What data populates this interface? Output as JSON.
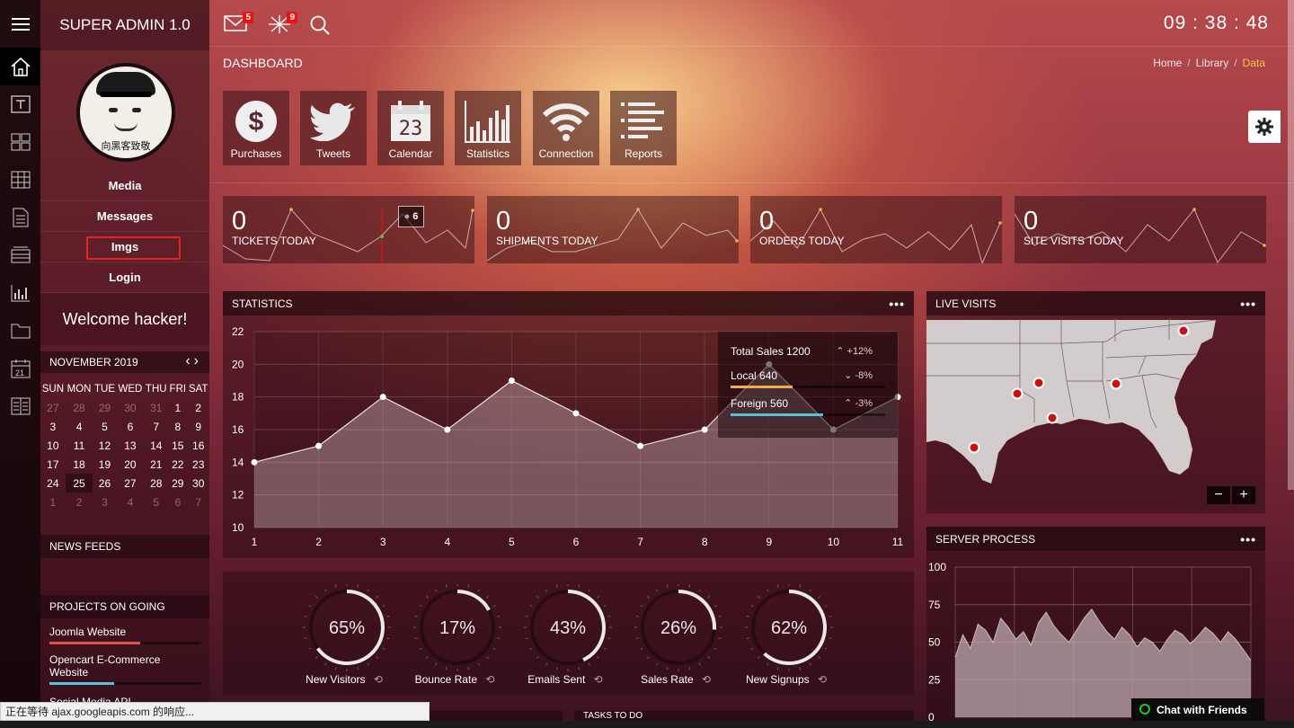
{
  "app": {
    "brand": "SUPER ADMIN 1.0"
  },
  "header": {
    "mail_badge": "5",
    "alerts_badge": "9",
    "clock": "09 : 38 : 48"
  },
  "page": {
    "title": "DASHBOARD",
    "breadcrumb": [
      "Home",
      "Library",
      "Data"
    ]
  },
  "sidebar": {
    "avatar_caption": "向黑客致敬",
    "links": [
      "Media",
      "Messages",
      "Imgs",
      "Login"
    ],
    "welcome": "Welcome hacker!",
    "calendar": {
      "month": "NOVEMBER 2019",
      "days_of_week": [
        "SUN",
        "MON",
        "TUE",
        "WED",
        "THU",
        "FRI",
        "SAT"
      ],
      "weeks": [
        [
          "27",
          "28",
          "29",
          "30",
          "31",
          "1",
          "2"
        ],
        [
          "3",
          "4",
          "5",
          "6",
          "7",
          "8",
          "9"
        ],
        [
          "10",
          "11",
          "12",
          "13",
          "14",
          "15",
          "16"
        ],
        [
          "17",
          "18",
          "19",
          "20",
          "21",
          "22",
          "23"
        ],
        [
          "24",
          "25",
          "26",
          "27",
          "28",
          "29",
          "30"
        ],
        [
          "1",
          "2",
          "3",
          "4",
          "5",
          "6",
          "7"
        ]
      ],
      "today": "25"
    },
    "news_title": "NEWS FEEDS",
    "projects_title": "PROJECTS ON GOING",
    "projects": [
      {
        "name": "Joomla Website",
        "progress": 0.6,
        "color": "#e0514f"
      },
      {
        "name": "Opencart E-Commerce Website",
        "progress": 0.43,
        "color": "#5bc0de"
      },
      {
        "name": "Social Media API",
        "progress": 0.3,
        "color": "#f0ad4e"
      }
    ]
  },
  "shortcuts": [
    "Purchases",
    "Tweets",
    "Calendar",
    "Statistics",
    "Connection",
    "Reports"
  ],
  "calendar_tile_day": "23",
  "stat_cards": [
    {
      "value": "0",
      "label": "TICKETS TODAY"
    },
    {
      "value": "0",
      "label": "SHIPMENTS TODAY"
    },
    {
      "value": "0",
      "label": "ORDERS TODAY"
    },
    {
      "value": "0",
      "label": "SITE VISITS TODAY"
    }
  ],
  "tickets_tooltip": "6",
  "statistics": {
    "title": "STATISTICS",
    "legend": [
      {
        "label": "Total Sales 1200",
        "trend": "up",
        "pct": "+12%",
        "color": "",
        "bar": 0
      },
      {
        "label": "Local 640",
        "trend": "down",
        "pct": "-8%",
        "color": "#f0ad4e",
        "bar": 0.4
      },
      {
        "label": "Foreign 560",
        "trend": "up",
        "pct": "-3%",
        "color": "#5bc0de",
        "bar": 0.6
      }
    ]
  },
  "chart_data": [
    {
      "type": "area",
      "title": "STATISTICS",
      "x": [
        1,
        2,
        3,
        4,
        5,
        6,
        7,
        8,
        9,
        10,
        11
      ],
      "series": [
        {
          "name": "",
          "values": [
            14,
            15,
            18,
            16,
            19,
            17,
            15,
            16,
            20,
            16,
            18
          ]
        }
      ],
      "ylim": [
        10,
        22
      ],
      "yticks": [
        10,
        12,
        14,
        16,
        18,
        20,
        22
      ],
      "grid": true
    },
    {
      "type": "area",
      "title": "SERVER PROCESS",
      "ylim": [
        0,
        100
      ],
      "yticks": [
        0,
        25,
        50,
        75,
        100
      ],
      "series": [
        {
          "name": "",
          "values": [
            40,
            55,
            46,
            62,
            58,
            50,
            66,
            60,
            52,
            57,
            48,
            63,
            70,
            61,
            55,
            50,
            58,
            66,
            72,
            64,
            57,
            52,
            60,
            55,
            47,
            53,
            50,
            44,
            52,
            58,
            55,
            49,
            54,
            60,
            56,
            50,
            57,
            52,
            45,
            38
          ]
        }
      ],
      "grid": true
    }
  ],
  "gauges": [
    {
      "value": "65%",
      "label": "New Visitors",
      "pct": 0.65
    },
    {
      "value": "17%",
      "label": "Bounce Rate",
      "pct": 0.17
    },
    {
      "value": "43%",
      "label": "Emails Sent",
      "pct": 0.43
    },
    {
      "value": "26%",
      "label": "Sales Rate",
      "pct": 0.26
    },
    {
      "value": "62%",
      "label": "New Signups",
      "pct": 0.62
    }
  ],
  "live_visits": {
    "title": "LIVE VISITS",
    "zoom_out": "−",
    "zoom_in": "+"
  },
  "server_process": {
    "title": "SERVER PROCESS"
  },
  "todo_title": "TASKS TO DO",
  "status_text": "正在等待 ajax.googleapis.com 的响应...",
  "chat_label": "Chat with Friends"
}
